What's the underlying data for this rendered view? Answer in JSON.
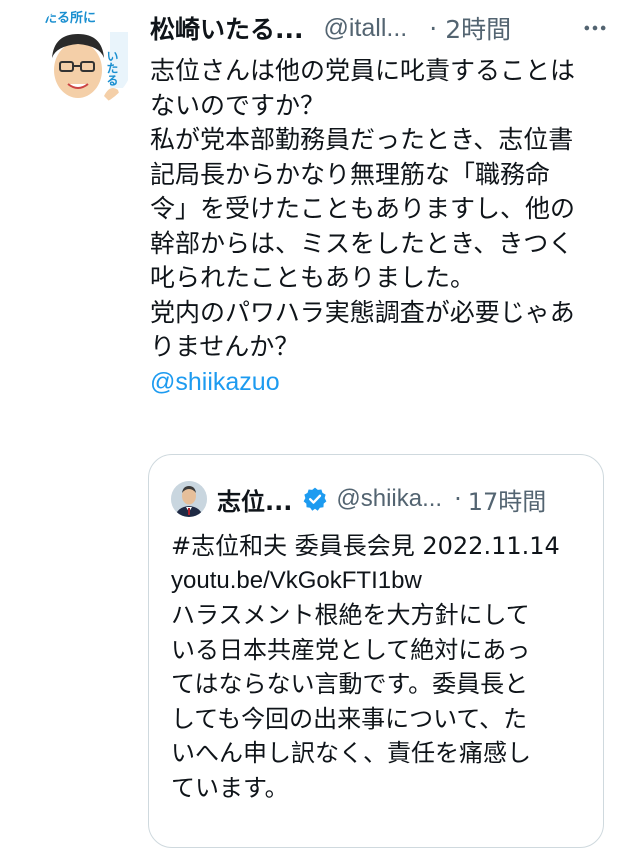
{
  "tweet": {
    "author_name": "松崎いたる...",
    "handle": "@itall...",
    "separator": "·",
    "time": "2時間",
    "avatar_sign_top": "たる所に",
    "avatar_sign_side": "いたる",
    "lines": [
      "志位さんは他の党員に叱責することは",
      "ないのですか？",
      "私が党本部勤務員だったとき、志位書",
      "記局長からかなり無理筋な「職務命",
      "令」を受けたこともありますし、他の",
      "幹部からは、ミスをしたとき、きつく",
      "叱られたこともありました。",
      "党内のパワハラ実態調査が必要じゃあ",
      "りませんか？"
    ],
    "mention": "@shiikazuo",
    "more_icon": "more-horizontal-icon"
  },
  "quote": {
    "author_name": "志位...",
    "handle": "@shiika...",
    "separator": "·",
    "time": "17時間",
    "verified_icon": "verified-badge-icon",
    "hashtag_line": "#志位和夫 委員長会見  2022.11.14",
    "link": "youtu.be/VkGokFTI1bw",
    "lines": [
      "ハラスメント根絶を大方針にして",
      "いる日本共産党として絶対にあっ",
      "てはならない言動です。委員長と",
      "しても今回の出来事について、た",
      "いへん申し訳なく、責任を痛感し",
      "ています。"
    ]
  },
  "colors": {
    "text": "#0f1419",
    "secondary": "#536471",
    "link": "#1d9bf0",
    "border": "#cfd9de"
  }
}
